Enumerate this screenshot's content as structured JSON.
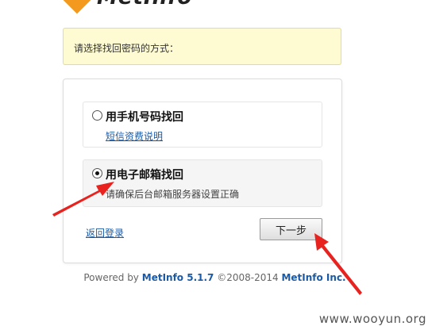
{
  "logo": {
    "text": "MetInfo"
  },
  "notice": {
    "text": "请选择找回密码的方式："
  },
  "options": [
    {
      "title": "用手机号码找回",
      "link": "短信资费说明",
      "selected": false
    },
    {
      "title": "用电子邮箱找回",
      "hint": "请确保后台邮箱服务器设置正确",
      "selected": true
    }
  ],
  "actions": {
    "back_label": "返回登录",
    "next_label": "下一步"
  },
  "footer": {
    "powered_by": "Powered by",
    "product": "MetInfo 5.1.7",
    "copyright": "©2008-2014",
    "company": "MetInfo Inc."
  },
  "watermark": "www.wooyun.org",
  "colors": {
    "arrow": "#e8231f",
    "link": "#1a5aa6",
    "notice_bg": "#fefbd3",
    "logo_orange": "#f39a1e"
  }
}
